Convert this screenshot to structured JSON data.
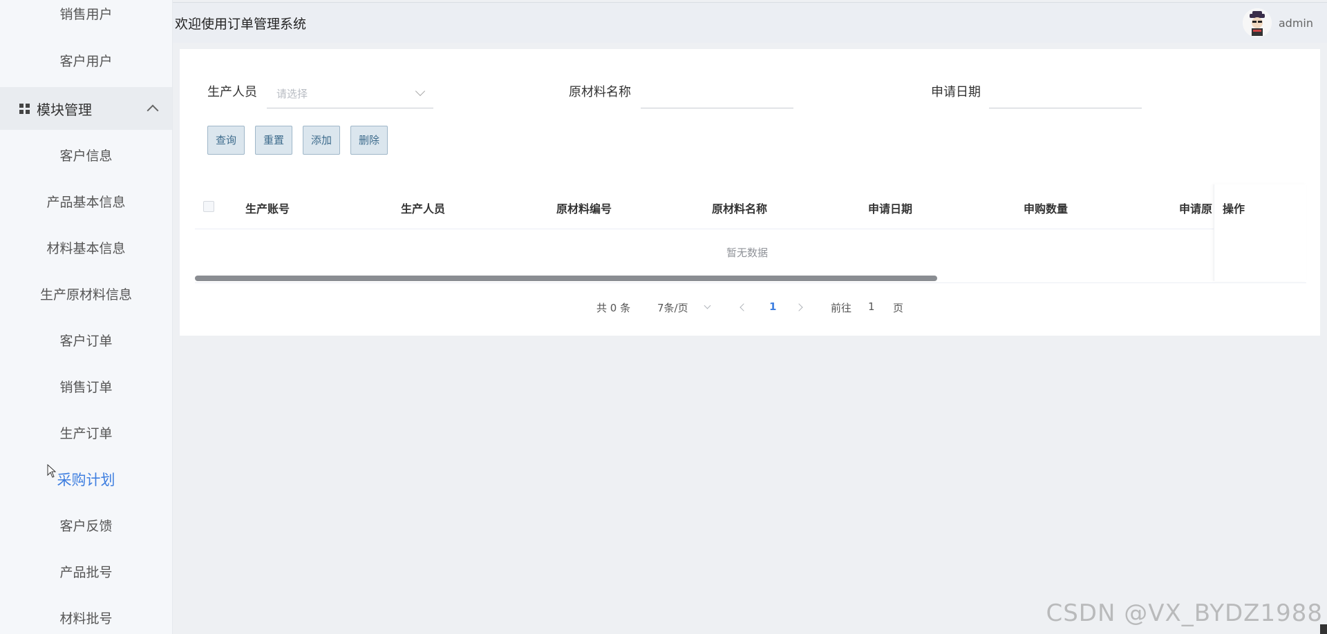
{
  "sidebar": {
    "items_top": [
      "销售用户",
      "客户用户"
    ],
    "group_label": "模块管理",
    "items": [
      "客户信息",
      "产品基本信息",
      "材料基本信息",
      "生产原材料信息",
      "客户订单",
      "销售订单",
      "生产订单",
      "采购计划",
      "客户反馈",
      "产品批号",
      "材料批号"
    ],
    "active_item": "采购计划",
    "active_color": "#3f7fe0"
  },
  "header": {
    "title": "欢迎使用订单管理系统",
    "user": "admin"
  },
  "filters": {
    "producer_label": "生产人员",
    "producer_placeholder": "请选择",
    "material_name_label": "原材料名称",
    "apply_date_label": "申请日期"
  },
  "buttons": {
    "query": "查询",
    "reset": "重置",
    "add": "添加",
    "delete": "删除"
  },
  "table": {
    "columns": [
      "生产账号",
      "生产人员",
      "原材料编号",
      "原材料名称",
      "申请日期",
      "申购数量",
      "申请原"
    ],
    "action_column": "操作",
    "empty_text": "暂无数据"
  },
  "pagination": {
    "total_text": "共 0 条",
    "page_size": "7条/页",
    "current_page": "1",
    "goto_label": "前往",
    "goto_value": "1",
    "page_suffix": "页"
  },
  "watermark": "CSDN @VX_BYDZ1988"
}
